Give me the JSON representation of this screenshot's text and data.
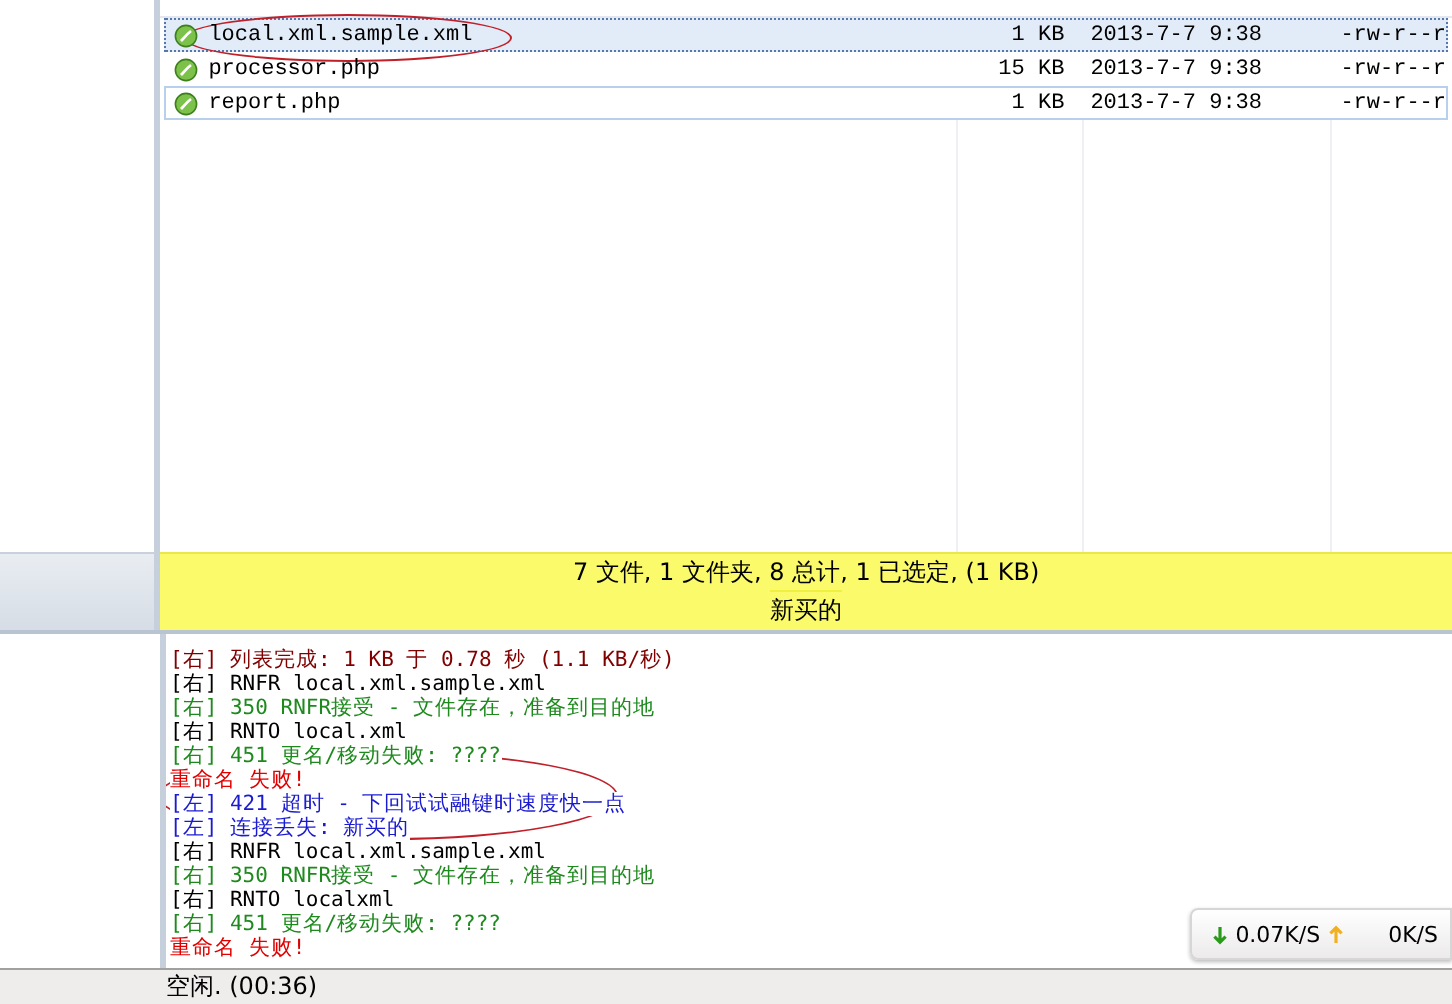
{
  "files": {
    "rows": [
      {
        "name": "local.xml.sample.xml",
        "size": "1 KB",
        "modified": "2013-7-7 9:38",
        "permissions": "-rw-r--r",
        "selected": true,
        "hovered": false,
        "circled": true
      },
      {
        "name": "processor.php",
        "size": "15 KB",
        "modified": "2013-7-7 9:38",
        "permissions": "-rw-r--r",
        "selected": false,
        "hovered": false,
        "circled": false
      },
      {
        "name": "report.php",
        "size": "1 KB",
        "modified": "2013-7-7 9:38",
        "permissions": "-rw-r--r",
        "selected": false,
        "hovered": true,
        "circled": false
      }
    ]
  },
  "summary": {
    "counts": "7 文件, 1 文件夹, 8 总计, 1 已选定, (1 KB)",
    "folder": "新买的"
  },
  "log": {
    "lines": [
      {
        "text": "[右] 列表完成: 1 KB 于 0.78 秒 (1.1 KB/秒)",
        "kind": "listing",
        "circled": false
      },
      {
        "text": "[右] RNFR local.xml.sample.xml",
        "kind": "command",
        "circled": false
      },
      {
        "text": "[右] 350 RNFR接受 - 文件存在，准备到目的地",
        "kind": "reply",
        "circled": false
      },
      {
        "text": "[右] RNTO local.xml",
        "kind": "command",
        "circled": false
      },
      {
        "text": "[右] 451 更名/移动失败: ????",
        "kind": "reply",
        "circled": true
      },
      {
        "text": "重命名 失败!",
        "kind": "error",
        "circled": true
      },
      {
        "text": "[左] 421 超时 - 下回试试融键时速度快一点",
        "kind": "local",
        "circled": true
      },
      {
        "text": "[左] 连接丢失: 新买的",
        "kind": "local",
        "circled": true
      },
      {
        "text": "[右] RNFR local.xml.sample.xml",
        "kind": "command",
        "circled": false
      },
      {
        "text": "[右] 350 RNFR接受 - 文件存在，准备到目的地",
        "kind": "reply",
        "circled": false
      },
      {
        "text": "[右] RNTO localxml",
        "kind": "command",
        "circled": false
      },
      {
        "text": "[右] 451 更名/移动失败: ????",
        "kind": "reply",
        "circled": false
      },
      {
        "text": "重命名 失败!",
        "kind": "error",
        "circled": false
      }
    ]
  },
  "speed": {
    "download": "0.07K/S",
    "upload": "0K/S"
  },
  "status_bar": {
    "text": "空闲. (00:36)"
  }
}
